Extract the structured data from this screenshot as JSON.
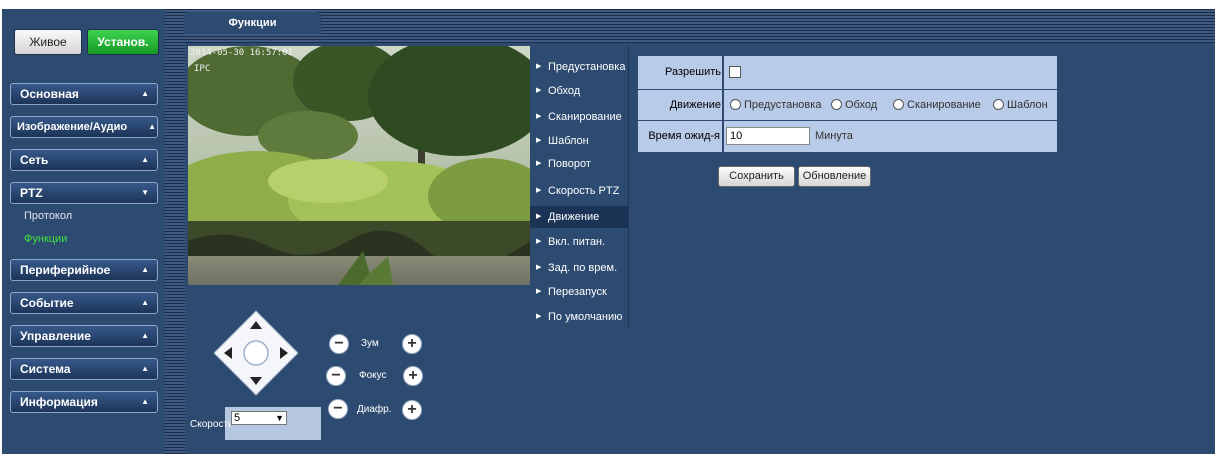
{
  "header": {
    "tab_title": "Функции"
  },
  "top_buttons": {
    "live": "Живое",
    "setup": "Установ."
  },
  "sidebar": {
    "menu": [
      "Основная",
      "Изображение/Аудио",
      "Сеть",
      "PTZ",
      "Периферийное",
      "Событие",
      "Управление",
      "Система",
      "Информация"
    ],
    "ptz_sub": {
      "protocol": "Протокол",
      "functions": "Функции"
    }
  },
  "video": {
    "osd_time": "2014-05-30 16:57:01",
    "osd_name": "IPC"
  },
  "ptz": {
    "zoom": "Зум",
    "focus": "Фокус",
    "iris": "Диафр.",
    "speed_label": "Скорость",
    "speed_value": "5"
  },
  "functions": [
    "Предустановка",
    "Обход",
    "Сканирование",
    "Шаблон",
    "Поворот",
    "Скорость PTZ",
    "Движение",
    "Вкл. питан.",
    "Зад. по врем.",
    "Перезапуск",
    "По умолчанию"
  ],
  "form": {
    "enable_label": "Разрешить",
    "motion_label": "Движение",
    "motion_options": [
      "Предустановка",
      "Обход",
      "Сканирование",
      "Шаблон"
    ],
    "timeout_label": "Время ожид-я",
    "timeout_value": "10",
    "timeout_unit": "Минута",
    "save_button": "Сохранить",
    "refresh_button": "Обновление"
  },
  "colors": {
    "panel": "#2d4a70",
    "form_row": "#b8cbe8",
    "active_sub": "#3fe03f",
    "setup_green": "#169a25"
  }
}
